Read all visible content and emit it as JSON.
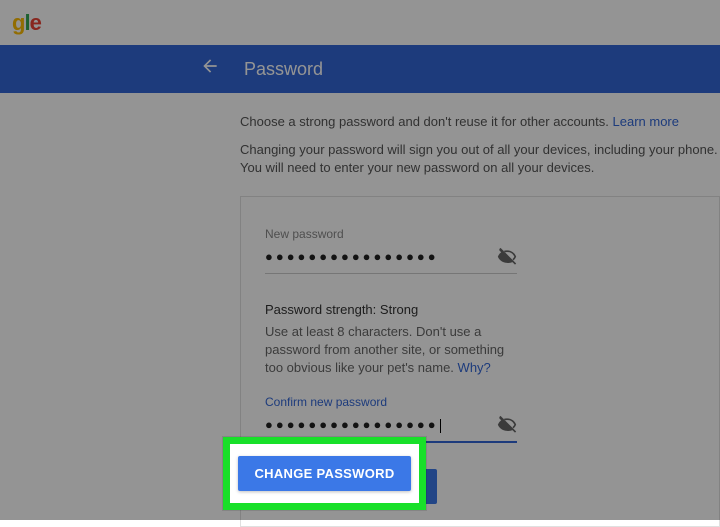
{
  "logo": {
    "visible_fragment": "gle"
  },
  "header": {
    "title": "Password"
  },
  "intro": {
    "line1": "Choose a strong password and don't reuse it for other accounts.",
    "learn_more": "Learn more",
    "line2": "Changing your password will sign you out of all your devices, including your phone. You will need to enter your new password on all your devices."
  },
  "form": {
    "new_password_label": "New password",
    "new_password_dots": "●●●●●●●●●●●●●●●●",
    "strength_label": "Password strength:",
    "strength_value": "Strong",
    "hint": "Use at least 8 characters. Don't use a password from another site, or something too obvious like your pet's name.",
    "why_link": "Why?",
    "confirm_label": "Confirm new password",
    "confirm_dots": "●●●●●●●●●●●●●●●●",
    "button_label": "CHANGE PASSWORD"
  },
  "icons": {
    "eye_off": "visibility-off-icon",
    "back": "back-arrow-icon"
  }
}
